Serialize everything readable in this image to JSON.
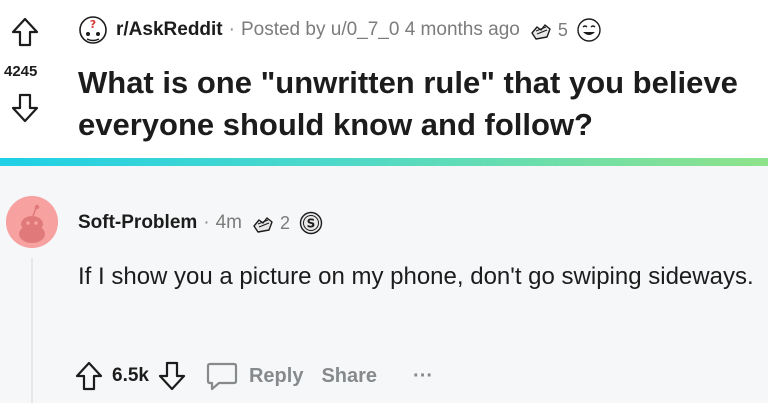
{
  "post": {
    "subreddit": "r/AskReddit",
    "separator": "·",
    "posted_by": "Posted by u/0_7_0 4 months ago",
    "award_count": "5",
    "score": "4245",
    "title": "What is one \"unwritten rule\" that you believe everyone should know and follow?"
  },
  "comment": {
    "author": "Soft-Problem",
    "separator": "·",
    "time": "4m",
    "award_count": "2",
    "body": "If I show you a picture on my phone, don't go swiping sideways.",
    "vote_count": "6.5k",
    "reply_label": "Reply",
    "share_label": "Share",
    "more_label": "···"
  },
  "colors": {
    "divider_start": "#1fd0e6",
    "divider_end": "#8ee38a",
    "comment_bg": "#f6f7f8",
    "muted_text": "#878a8c",
    "avatar_bg": "#f7a1a1"
  }
}
